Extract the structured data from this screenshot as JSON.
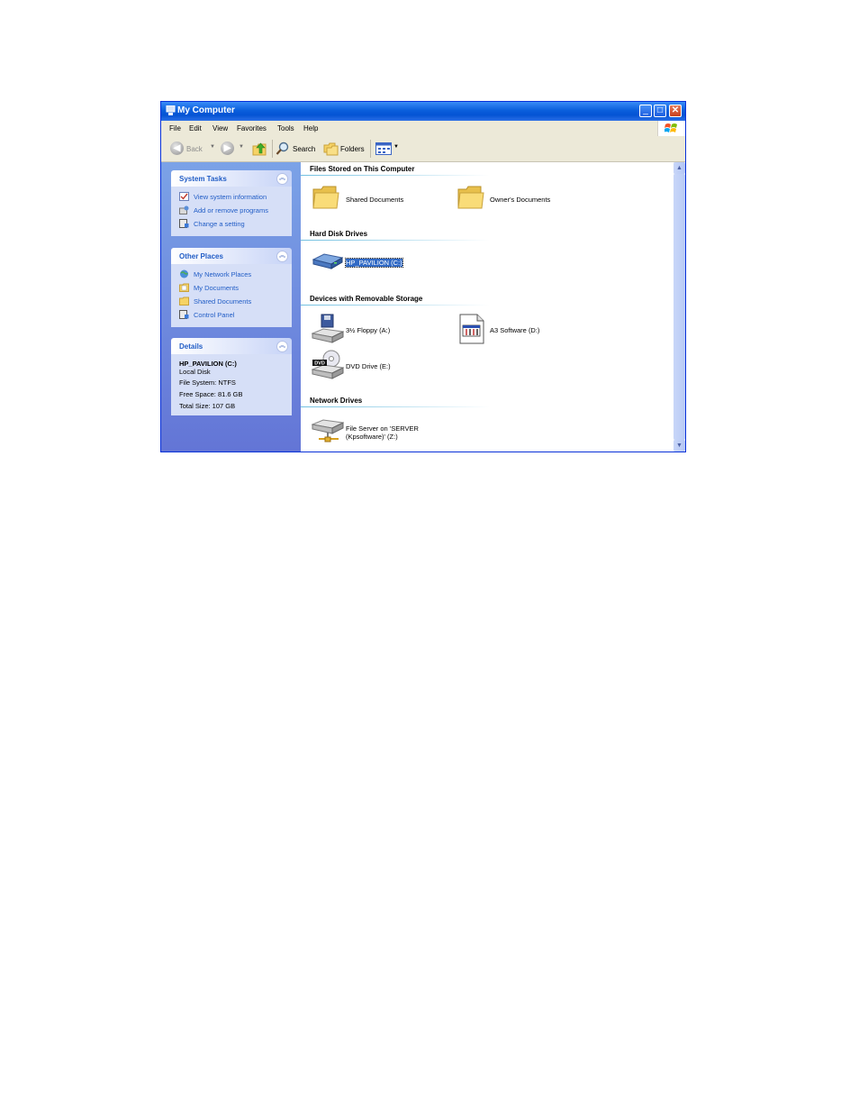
{
  "window": {
    "title": "My Computer",
    "buttons": {
      "minimize": "_",
      "maximize": "□",
      "close": "✕"
    }
  },
  "menubar": [
    "File",
    "Edit",
    "View",
    "Favorites",
    "Tools",
    "Help"
  ],
  "toolbar": {
    "back_label": "Back",
    "search_label": "Search",
    "folders_label": "Folders"
  },
  "left_panels": {
    "system_tasks": {
      "title": "System Tasks",
      "items": [
        "View system information",
        "Add or remove programs",
        "Change a setting"
      ]
    },
    "other_places": {
      "title": "Other Places",
      "items": [
        "My Network Places",
        "My Documents",
        "Shared Documents",
        "Control Panel"
      ]
    },
    "details": {
      "title": "Details",
      "name": "HP_PAVILION (C:)",
      "type": "Local Disk",
      "file_system": "File System: NTFS",
      "free_space": "Free Space: 81.6 GB",
      "total_size": "Total Size: 107 GB"
    }
  },
  "sections": {
    "files": {
      "title": "Files Stored on This Computer",
      "items": [
        "Shared Documents",
        "Owner's Documents"
      ]
    },
    "hard_disks": {
      "title": "Hard Disk Drives",
      "items": [
        "HP_PAVILION (C:)"
      ]
    },
    "removable": {
      "title": "Devices with Removable Storage",
      "items": [
        "3½ Floppy (A:)",
        "A3 Software (D:)",
        "DVD Drive (E:)"
      ],
      "dvd_badge": "DVD"
    },
    "network": {
      "title": "Network Drives",
      "line1": "File Server on 'SERVER",
      "line2": "(Kpsoftware)' (Z:)"
    }
  },
  "colors": {
    "title_bar": "#0a5fdc",
    "left_pane": "#6f8fdf",
    "link_text": "#215dc6",
    "selection": "#316ac5"
  }
}
